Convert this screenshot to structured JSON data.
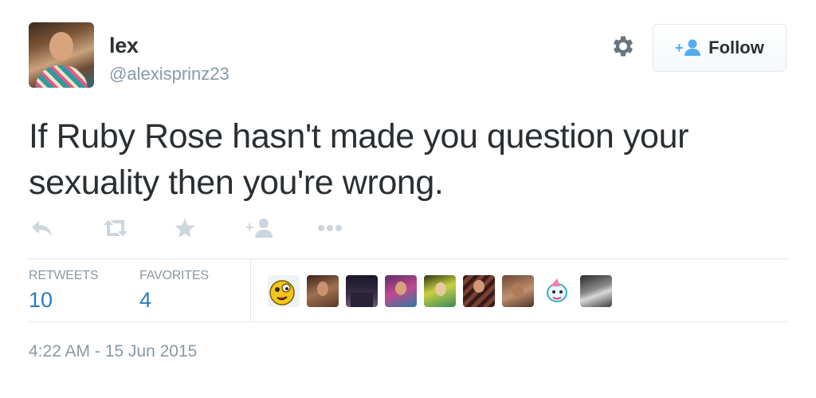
{
  "user": {
    "name": "lex",
    "handle": "@alexisprinz23"
  },
  "follow_button": {
    "label": "Follow"
  },
  "tweet": {
    "text": "If Ruby Rose hasn't made you question your sexuality then you're wrong."
  },
  "actions": [
    "reply-icon",
    "retweet-icon",
    "favorite-icon",
    "follow-icon",
    "more-icon"
  ],
  "stats": {
    "retweets_label": "RETWEETS",
    "retweets_value": "10",
    "favorites_label": "FAVORITES",
    "favorites_value": "4"
  },
  "timestamp": "4:22 AM - 15 Jun 2015",
  "colors": {
    "text": "#292f33",
    "muted": "#8899a6",
    "link": "#2b7bb9",
    "action_icon": "#ccd6dd",
    "border": "#e1e8ed"
  }
}
